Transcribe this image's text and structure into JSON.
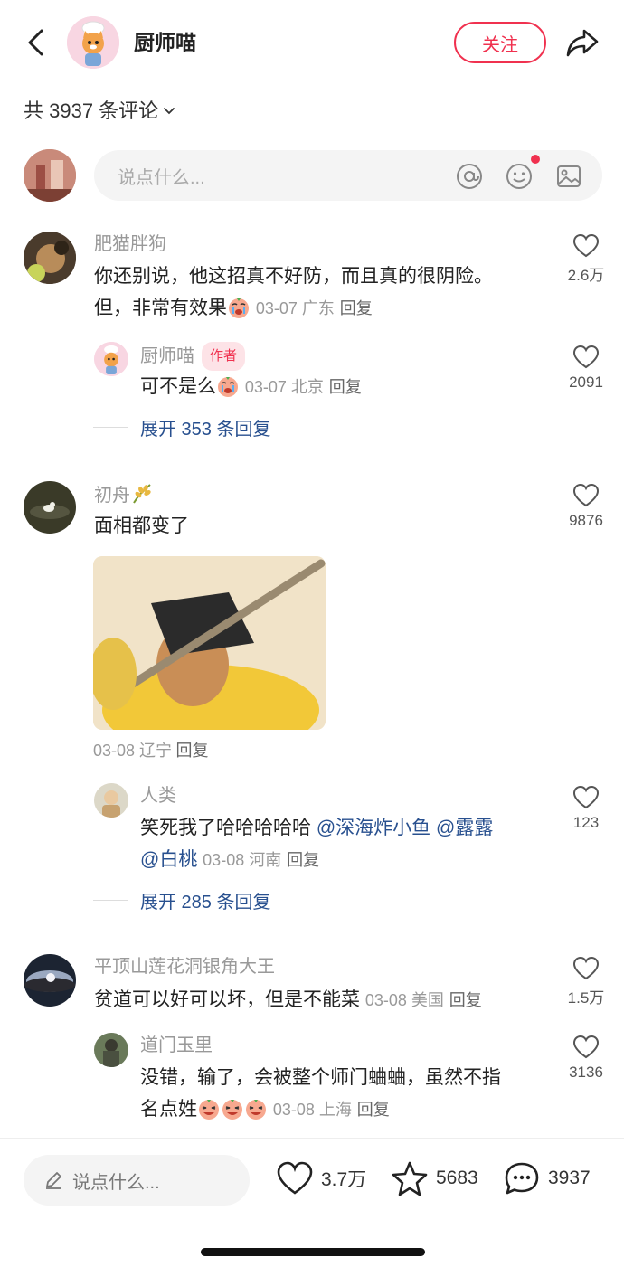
{
  "header": {
    "author_name": "厨师喵",
    "follow_label": "关注"
  },
  "comments_count_label": "共 3937 条评论",
  "input_placeholder": "说点什么...",
  "comments": [
    {
      "name": "肥猫胖狗",
      "text_line1": "你还别说，他这招真不好防，而且真的很阴险。",
      "text_line2": "但，非常有效果",
      "meta": "03-07 广东",
      "reply": "回复",
      "likes": "2.6万",
      "sub": {
        "name": "厨师喵",
        "tag": "作者",
        "text": "可不是么",
        "meta": "03-07 北京",
        "reply": "回复",
        "likes": "2091"
      },
      "expand": "展开 353 条回复"
    },
    {
      "name": "初舟",
      "text": "面相都变了",
      "meta": "03-08 辽宁",
      "reply": "回复",
      "likes": "9876",
      "sub": {
        "name": "人类",
        "text_line1": "笑死我了哈哈哈哈哈",
        "mention1": "@深海炸小鱼",
        "mention2": "@露露",
        "mention3": "@白桃",
        "meta": "03-08 河南",
        "reply": "回复",
        "likes": "123"
      },
      "expand": "展开 285 条回复"
    },
    {
      "name": "平顶山莲花洞银角大王",
      "text": "贫道可以好可以坏，但是不能菜",
      "meta": "03-08 美国",
      "reply": "回复",
      "likes": "1.5万",
      "sub": {
        "name": "道门玉里",
        "text_line1": "没错，输了，会被整个师门蛐蛐，虽然不指",
        "text_line2": "名点姓",
        "meta": "03-08 上海",
        "reply": "回复",
        "likes": "3136"
      }
    }
  ],
  "bottom": {
    "placeholder": "说点什么...",
    "likes": "3.7万",
    "favorites": "5683",
    "comments": "3937"
  },
  "colors": {
    "accent": "#f0314f",
    "mention": "#28508f"
  }
}
